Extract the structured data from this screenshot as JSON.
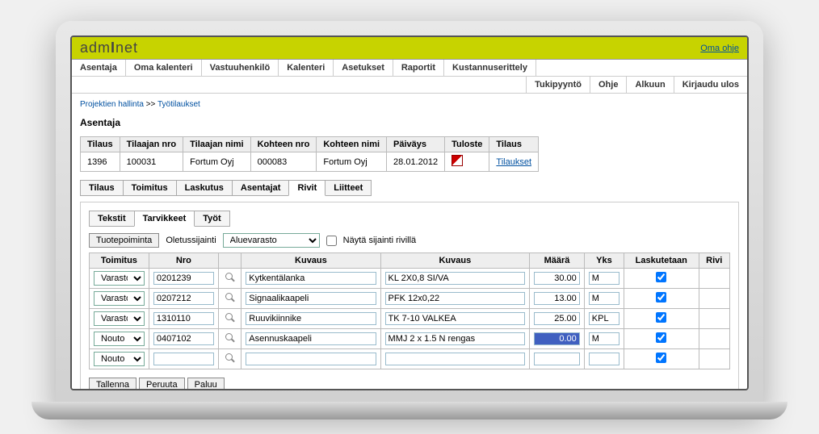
{
  "branding": {
    "logo_text": "admInet",
    "help_link": "Oma ohje"
  },
  "main_menu": [
    "Asentaja",
    "Oma kalenteri",
    "Vastuuhenkilö",
    "Kalenteri",
    "Asetukset",
    "Raportit",
    "Kustannuserittely"
  ],
  "sub_menu": [
    "Tukipyyntö",
    "Ohje",
    "Alkuun",
    "Kirjaudu ulos"
  ],
  "breadcrumb": {
    "a": "Projektien hallinta",
    "sep": " >> ",
    "b": "Työtilaukset"
  },
  "page_title": "Asentaja",
  "order_headers": [
    "Tilaus",
    "Tilaajan nro",
    "Tilaajan nimi",
    "Kohteen nro",
    "Kohteen nimi",
    "Päiväys",
    "Tuloste",
    "Tilaus"
  ],
  "order_row": {
    "tilaus": "1396",
    "tilaajan_nro": "100031",
    "tilaajan_nimi": "Fortum Oyj",
    "kohteen_nro": "000083",
    "kohteen_nimi": "Fortum Oyj",
    "paivays": "28.01.2012",
    "tilaukset_link": "Tilaukset"
  },
  "tabs1": [
    "Tilaus",
    "Toimitus",
    "Laskutus",
    "Asentajat",
    "Rivit",
    "Liitteet"
  ],
  "tabs1_active": 4,
  "tabs2": [
    "Tekstit",
    "Tarvikkeet",
    "Työt"
  ],
  "tabs2_active": 1,
  "toolbar": {
    "tuotepoiminta": "Tuotepoiminta",
    "oletussijainti_label": "Oletussijainti",
    "oletussijainti_value": "Aluevarasto",
    "nayta_sijainti_label": "Näytä sijainti rivillä"
  },
  "grid_headers": [
    "Toimitus",
    "Nro",
    "",
    "Kuvaus",
    "Kuvaus",
    "Määrä",
    "Yks",
    "Laskutetaan",
    "Rivi"
  ],
  "grid_rows": [
    {
      "toimitus": "Varasto",
      "nro": "0201239",
      "kuvaus1": "Kytkentälanka",
      "kuvaus2": "KL 2X0,8 SI/VA",
      "maara": "30.00",
      "yks": "M",
      "lask": true
    },
    {
      "toimitus": "Varasto",
      "nro": "0207212",
      "kuvaus1": "Signaalikaapeli",
      "kuvaus2": "PFK 12x0,22",
      "maara": "13.00",
      "yks": "M",
      "lask": true
    },
    {
      "toimitus": "Varasto",
      "nro": "1310110",
      "kuvaus1": "Ruuvikiinnike",
      "kuvaus2": "TK 7-10 VALKEA",
      "maara": "25.00",
      "yks": "KPL",
      "lask": true
    },
    {
      "toimitus": "Nouto",
      "nro": "0407102",
      "kuvaus1": "Asennuskaapeli",
      "kuvaus2": "MMJ 2 x 1.5 N rengas",
      "maara": "0.00",
      "yks": "M",
      "lask": true,
      "highlight_maara": true
    },
    {
      "toimitus": "Nouto",
      "nro": "",
      "kuvaus1": "",
      "kuvaus2": "",
      "maara": "",
      "yks": "",
      "lask": true
    }
  ],
  "buttons": {
    "tallenna": "Tallenna",
    "peruuta": "Peruuta",
    "paluu": "Paluu"
  }
}
